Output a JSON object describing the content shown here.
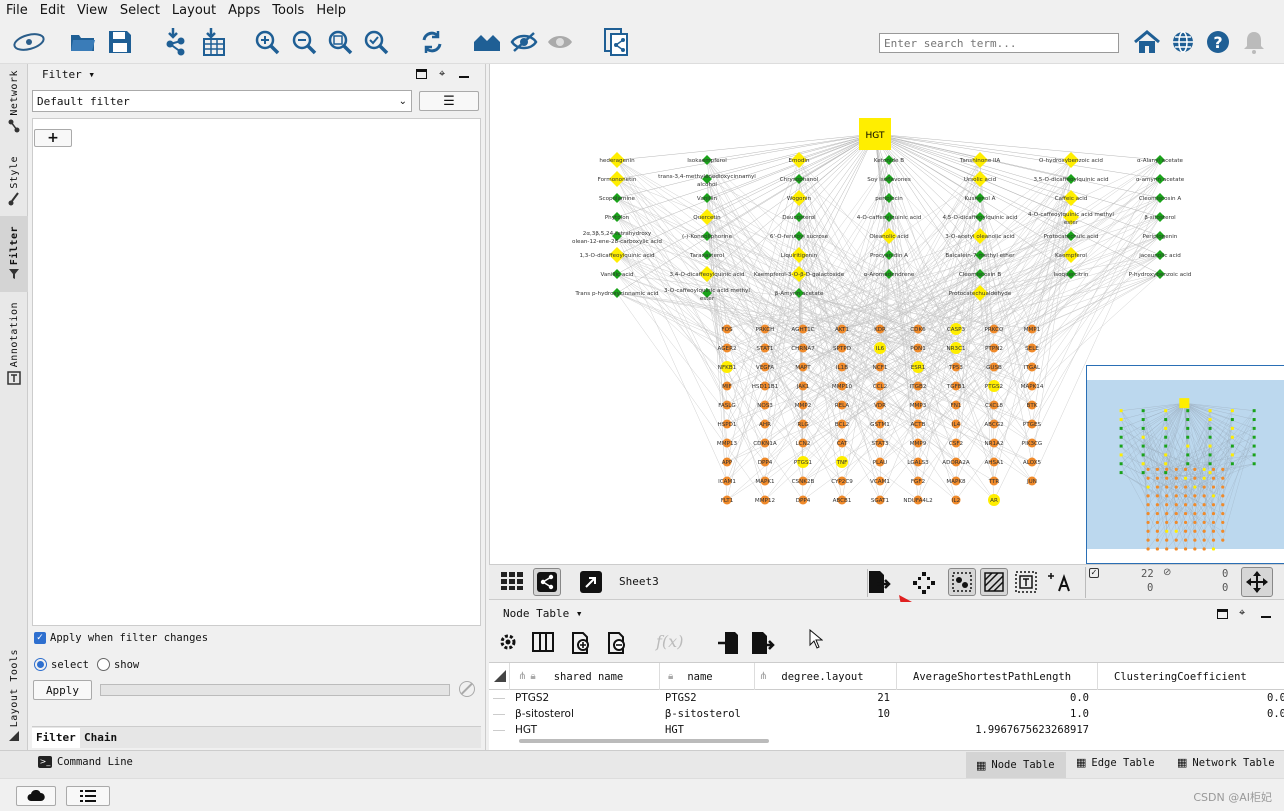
{
  "menu": [
    "File",
    "Edit",
    "View",
    "Select",
    "Layout",
    "Apps",
    "Tools",
    "Help"
  ],
  "toolbar": {
    "search_placeholder": "Enter search term..."
  },
  "left_tabs": {
    "network": "Network",
    "style": "Style",
    "filter": "Filter",
    "annotation": "Annotation",
    "layout_tools": "Layout Tools"
  },
  "filter_panel": {
    "title": "Filter",
    "default_filter": "Default filter",
    "add_label": "+",
    "apply_when_changes": "Apply when filter changes",
    "apply_when_changes_checked": true,
    "select_label": "select",
    "show_label": "show",
    "selected_mode": "select",
    "apply_button": "Apply",
    "tab_filter": "Filter",
    "tab_chain": "Chain"
  },
  "network": {
    "hub": "HGT",
    "compounds_col1": [
      "hederagenin",
      "Formononetin",
      "Scopolamine",
      "Phytolon",
      "2α,3β,5,24-tetrahydroxy olean-12-ene-28-carboxylic acid",
      "1,3-O-dicaffeoylquinic acid",
      "Vanillic acid",
      "Trans p-hydroxycinnamic acid"
    ],
    "compounds_col2": [
      "Isokaempferol",
      "trans-3,4-methylenedioxycinnamyl alcohol",
      "Vanillin",
      "Quercetin",
      "(-)-Koneoliphorine",
      "Taraxasterol",
      "3,4-O-dicaffeoylquinic acid",
      "3-O-caffeoylquinic acid methyl ester"
    ],
    "compounds_col3": [
      "Emodin",
      "Chrysophanol",
      "Wogonin",
      "Daucosterol",
      "6'-O-feruloyl sucrose",
      "Liquiritigenin",
      "Kaempferol-3-O-β-D-galactoside",
      "β-Amyrin acetate"
    ],
    "compounds_col4": [
      "Ketonide B",
      "Soy isoflavones",
      "periplocin",
      "4-O-caffeoylquinic acid",
      "Oleanolic acid",
      "Procyanidin A",
      "α-Aromadendrene"
    ],
    "compounds_col5": [
      "Tanshinone IIA",
      "Ursolic acid",
      "Kushenol A",
      "4,5-O-dicaffeoylquinic acid",
      "3-O-acetyl oleanolic acid",
      "Baicalein-7-methyl ether",
      "Cleomiscosin B",
      "Protocatechualdehyde"
    ],
    "compounds_col6": [
      "O-hydroxybenzoic acid",
      "3,5-O-dicaffeoylquinic acid",
      "Caffeic acid",
      "4-O-caffeoylquinic acid methyl ester",
      "Protocatechuic acid",
      "Kaempferol",
      "Isoquercitrin"
    ],
    "compounds_col7": [
      "α-Alanyl acetate",
      "α-amyrin acetate",
      "Cleomiscosin A",
      "β-sitosterol",
      "Periplogenin",
      "jaceunolic acid",
      "P-hydroxybenzoic acid"
    ],
    "targets": [
      [
        "FOS",
        "PRKCH",
        "AGHT1C",
        "AKT1",
        "KDR",
        "CDK6",
        "CASP3",
        "PRKCQ",
        "MMP1"
      ],
      [
        "AGER2",
        "STAT1",
        "CHRNA7",
        "SPTPD",
        "IL6",
        "PON1",
        "NR3C1",
        "PTPN2",
        "SELE"
      ],
      [
        "NFKB1",
        "VEGFA",
        "MAPT",
        "IL1B",
        "NCF1",
        "ESR1",
        "TP53",
        "GUSB",
        "ITGAL"
      ],
      [
        "MIF",
        "HSD11B1",
        "JAK1",
        "MMP10",
        "CCL2",
        "ITGB2",
        "TGFB1",
        "PTGS2",
        "MAPK14"
      ],
      [
        "FASLG",
        "NOS3",
        "MMP2",
        "RELA",
        "VDR",
        "MMP3",
        "FN1",
        "CXCL8",
        "BTK"
      ],
      [
        "HSPD1",
        "AHR",
        "RLG",
        "BCL2",
        "GSTM1",
        "ACTB",
        "IL4",
        "ABCG2",
        "PTGES"
      ],
      [
        "MMP13",
        "CDKN1A",
        "LCN2",
        "CAT",
        "STAT3",
        "MMP9",
        "CSF2",
        "NR1A2",
        "PIK3CG"
      ],
      [
        "APP",
        "DPP4",
        "PTGS1",
        "TNF",
        "PLAU",
        "LGALS3",
        "ADORA2A",
        "AHSA1",
        "ALOX5"
      ],
      [
        "ICAM1",
        "MAPK1",
        "CSNK2B",
        "CYP2C9",
        "VCAM1",
        "FGF2",
        "MAPK8",
        "TTR",
        "JUN"
      ],
      [
        "FLT1",
        "MMP12",
        "DPP4",
        "ABCB1",
        "SGAT1",
        "NDUFA4L2",
        "IL2",
        "AR",
        ""
      ]
    ]
  },
  "view_bar": {
    "sheet_name": "Sheet3",
    "selected_nodes": "22",
    "selected_edges": "0",
    "hidden_nodes": "0",
    "hidden_edges": "0"
  },
  "node_table": {
    "title": "Node Table",
    "columns": [
      "shared name",
      "name",
      "degree.layout",
      "AverageShortestPathLength",
      "ClusteringCoefficient"
    ],
    "rows": [
      [
        "PTGS2",
        "PTGS2",
        "21",
        "0.0",
        "0.0"
      ],
      [
        "β-sitosterol",
        "β-sitosterol",
        "10",
        "1.0",
        "0.0"
      ],
      [
        "HGT",
        "HGT",
        "",
        "1.9967675623268917",
        ""
      ]
    ]
  },
  "bottom": {
    "command_line": "Command Line",
    "node_table": "Node Table",
    "edge_table": "Edge Table",
    "network_table": "Network Table",
    "watermark": "CSDN @AI柜妃"
  },
  "colors": {
    "compound": "#1aa31a",
    "compound_selected": "#ffee00",
    "target": "#f08a2a",
    "target_selected": "#ffee00",
    "hub": "#ffee00",
    "overview_bg": "#bcd8ee",
    "arrow": "#e02020"
  }
}
